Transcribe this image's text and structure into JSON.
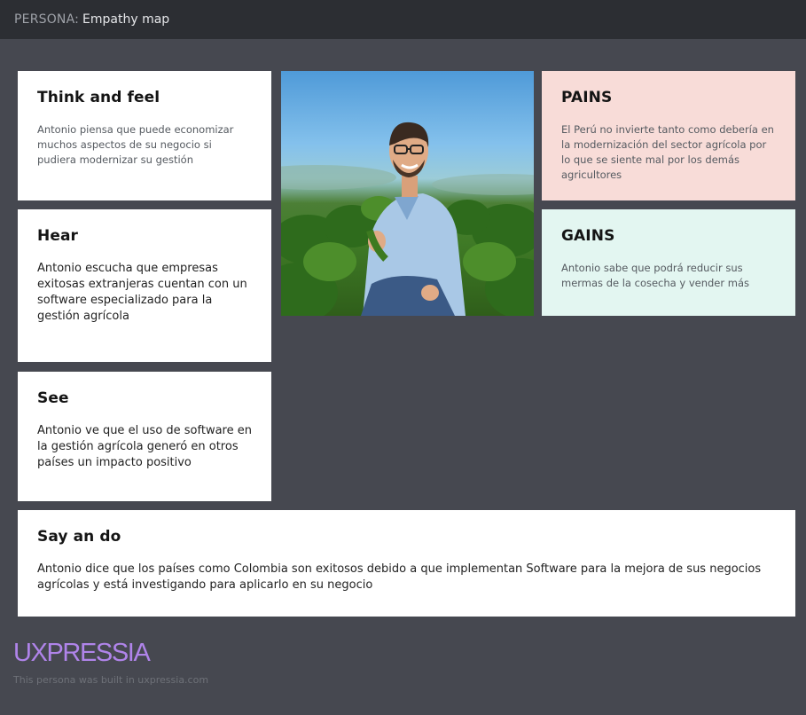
{
  "header": {
    "label": "PERSONA:",
    "title": "Empathy map"
  },
  "cards": {
    "think": {
      "title": "Think and feel",
      "text": "Antonio piensa que puede economizar muchos aspectos de su negocio si pudiera modernizar su gestión"
    },
    "hear": {
      "title": "Hear",
      "text": "Antonio escucha que empresas exitosas extranjeras cuentan con un software especializado para la gestión agrícola"
    },
    "see": {
      "title": "See",
      "text": "Antonio ve que el uso de software en la gestión agrícola generó en otros países un impacto positivo"
    },
    "say_and_do": {
      "title": "Say an do",
      "text": "Antonio dice que los países como Colombia son exitosos debido a que implementan Software para la mejora de sus negocios agrícolas y está investigando para aplicarlo en su negocio"
    },
    "pains": {
      "title": "PAINS",
      "text": "El Perú no invierte tanto como debería en la modernización del sector agrícola por lo que se siente mal por los demás agricultores"
    },
    "gains": {
      "title": "GAINS",
      "text": "Antonio sabe que podrá reducir sus mermas de la cosecha y vender más"
    }
  },
  "footer": {
    "brand": "UXPRESSIA",
    "note": "This persona was built in uxpressia.com"
  },
  "colors": {
    "background": "#464850",
    "topbar": "#2c2e33",
    "pains_bg": "#f8dcd8",
    "gains_bg": "#e3f6f1",
    "brand": "#b084ea"
  }
}
